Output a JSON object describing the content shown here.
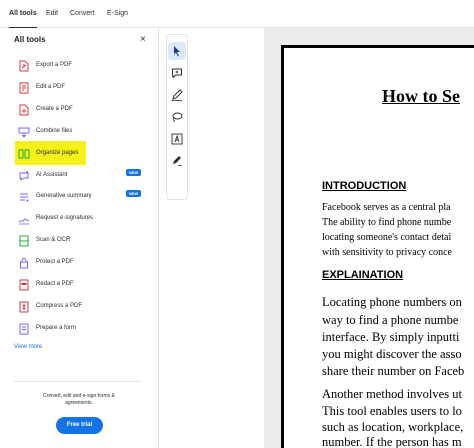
{
  "topbar": {
    "tabs": [
      {
        "label": "All tools"
      },
      {
        "label": "Edit"
      },
      {
        "label": "Convert"
      },
      {
        "label": "E-Sign"
      }
    ]
  },
  "panel": {
    "title": "All tools",
    "close_icon": "×",
    "tools": [
      {
        "label": "Export a PDF",
        "icon": "export-pdf-icon",
        "color": "#d7373f"
      },
      {
        "label": "Edit a PDF",
        "icon": "edit-pdf-icon",
        "color": "#d7373f"
      },
      {
        "label": "Create a PDF",
        "icon": "create-pdf-icon",
        "color": "#d7373f"
      },
      {
        "label": "Combine files",
        "icon": "combine-files-icon",
        "color": "#7b61ff"
      },
      {
        "label": "Organize pages",
        "icon": "organize-pages-icon",
        "color": "#2da44e"
      },
      {
        "label": "AI Assistant",
        "icon": "ai-assistant-icon",
        "color": "#7b61ff",
        "badge": "NEW"
      },
      {
        "label": "Generative summary",
        "icon": "generative-summary-icon",
        "color": "#7b61ff",
        "badge": "NEW"
      },
      {
        "label": "Request e-signatures",
        "icon": "request-esignatures-icon",
        "color": "#7b61ff"
      },
      {
        "label": "Scan & OCR",
        "icon": "scan-ocr-icon",
        "color": "#2da44e"
      },
      {
        "label": "Protect a PDF",
        "icon": "protect-pdf-icon",
        "color": "#7b61ff"
      },
      {
        "label": "Redact a PDF",
        "icon": "redact-pdf-icon",
        "color": "#d7373f"
      },
      {
        "label": "Compress a PDF",
        "icon": "compress-pdf-icon",
        "color": "#d7373f"
      },
      {
        "label": "Prepare a form",
        "icon": "prepare-form-icon",
        "color": "#7b61ff"
      }
    ],
    "view_more": "View more",
    "promo_text": "Convert, edit and e-sign forms & agreements.",
    "trial_button": "Free trial"
  },
  "toolbar": {
    "tools": [
      "select-cursor-icon",
      "add-comment-icon",
      "draw-pen-icon",
      "lasso-icon",
      "add-text-icon",
      "fill-sign-icon"
    ]
  },
  "document": {
    "title": "How to Se",
    "sections": {
      "intro_heading": "INTRODUCTION",
      "intro_lines": [
        "Facebook serves as a central pla",
        "The ability to find phone numbe",
        "locating someone's contact detai",
        "with sensitivity to privacy conce"
      ],
      "expl_heading": "EXPLAINATION",
      "para1_lines": [
        "Locating phone numbers on",
        "way to find a phone numbe",
        "interface. By simply inputti",
        "you might discover the asso",
        "share their number on Faceb"
      ],
      "para2_lines": [
        "Another method involves ut",
        "This tool enables users to lo",
        "such as location, workplace,",
        "number. If the person has m"
      ]
    }
  },
  "colors": {
    "accent": "#1473e6",
    "highlight": "#f2f21a",
    "active_tool_bg": "#dce8fb"
  }
}
